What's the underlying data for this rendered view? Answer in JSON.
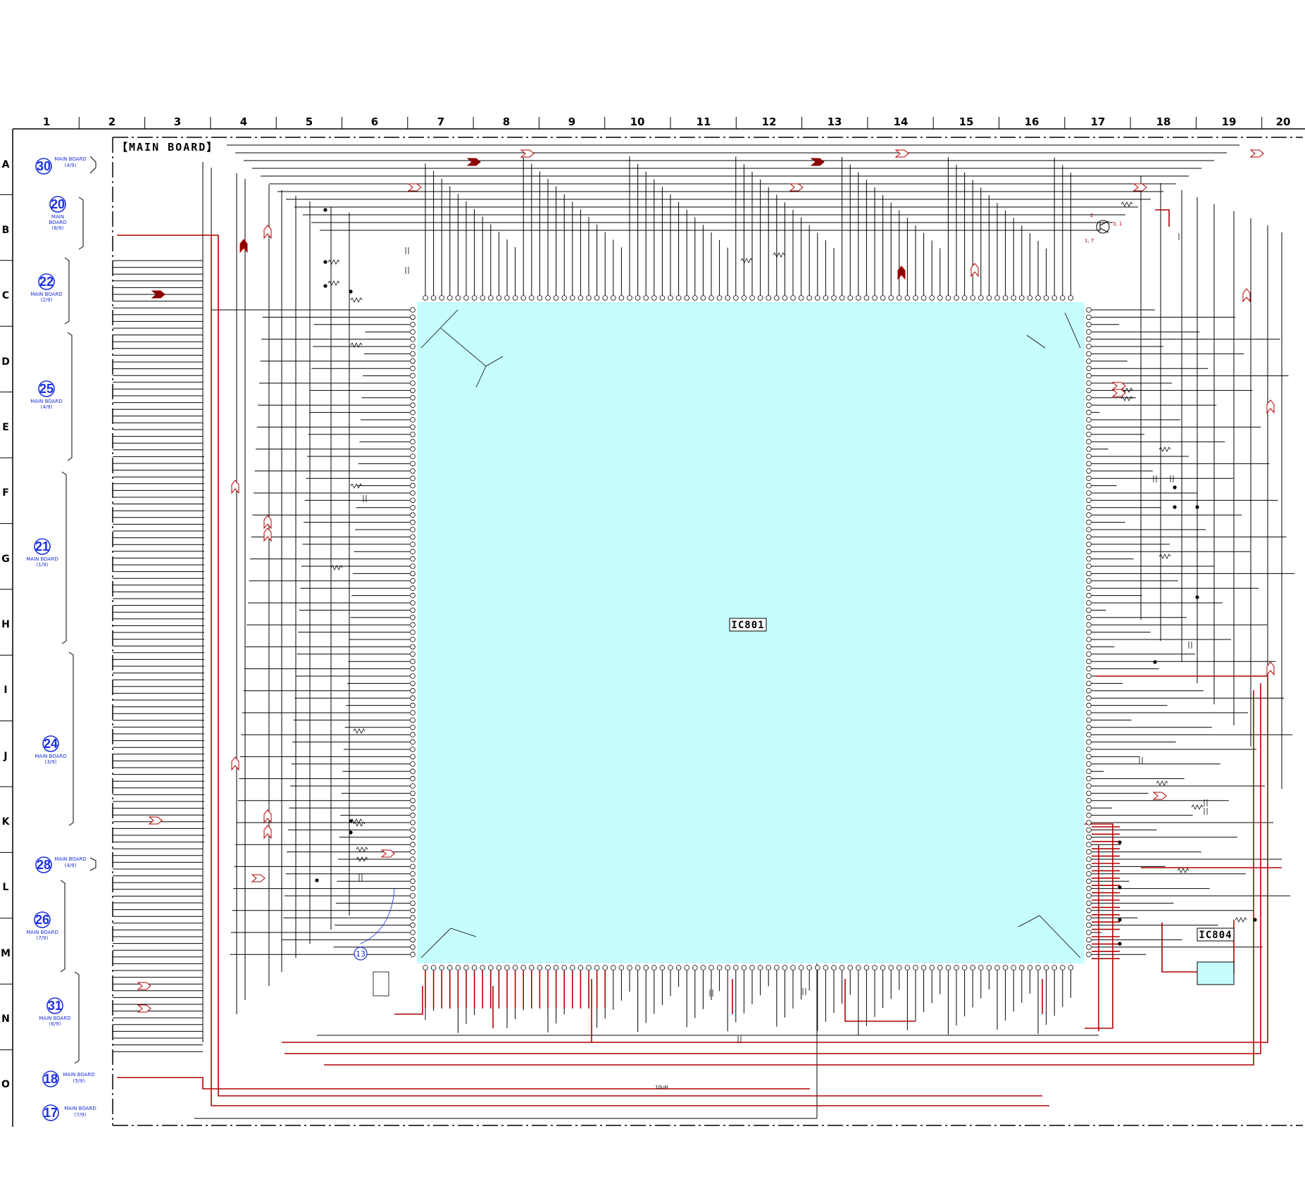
{
  "grid": {
    "columns": [
      "1",
      "2",
      "3",
      "4",
      "5",
      "6",
      "7",
      "8",
      "9",
      "10",
      "11",
      "12",
      "13",
      "14",
      "15",
      "16",
      "17",
      "18",
      "19",
      "20"
    ],
    "rows": [
      "A",
      "B",
      "C",
      "D",
      "E",
      "F",
      "G",
      "H",
      "I",
      "J",
      "K",
      "L",
      "M",
      "N",
      "O"
    ]
  },
  "board_title": "【MAIN BOARD】",
  "connectors": [
    {
      "num": "30",
      "line1": "MAIN BOARD",
      "line2": "(4/9)"
    },
    {
      "num": "20",
      "line1": "MAIN",
      "line2": "BOARD",
      "line3": "(8/9)"
    },
    {
      "num": "22",
      "line1": "MAIN BOARD",
      "line2": "(2/9)"
    },
    {
      "num": "25",
      "line1": "MAIN BOARD",
      "line2": "(4/9)"
    },
    {
      "num": "21",
      "line1": "MAIN BOARD",
      "line2": "(1/9)"
    },
    {
      "num": "24",
      "line1": "MAIN BOARD",
      "line2": "(3/9)"
    },
    {
      "num": "28",
      "line1": "MAIN BOARD",
      "line2": "(4/9)"
    },
    {
      "num": "26",
      "line1": "MAIN BOARD",
      "line2": "(7/9)"
    },
    {
      "num": "31",
      "line1": "MAIN BOARD",
      "line2": "(6/9)"
    },
    {
      "num": "18",
      "line1": "MAIN BOARD",
      "line2": "(5/9)"
    },
    {
      "num": "17",
      "line1": "MAIN BOARD",
      "line2": "(7/9)"
    }
  ],
  "ics": {
    "main": "IC801",
    "secondary": "IC804"
  },
  "labels": {
    "inductor": "10uH",
    "callout": "13",
    "transistor_pins": [
      "2",
      "3, 1",
      "1, 7"
    ]
  },
  "colors": {
    "ic_fill": "#c6fdfd",
    "wire": "#000000",
    "red_wire": "#b00000",
    "connector_blue": "#1a2fe0",
    "arrow_red": "#8b0000"
  }
}
